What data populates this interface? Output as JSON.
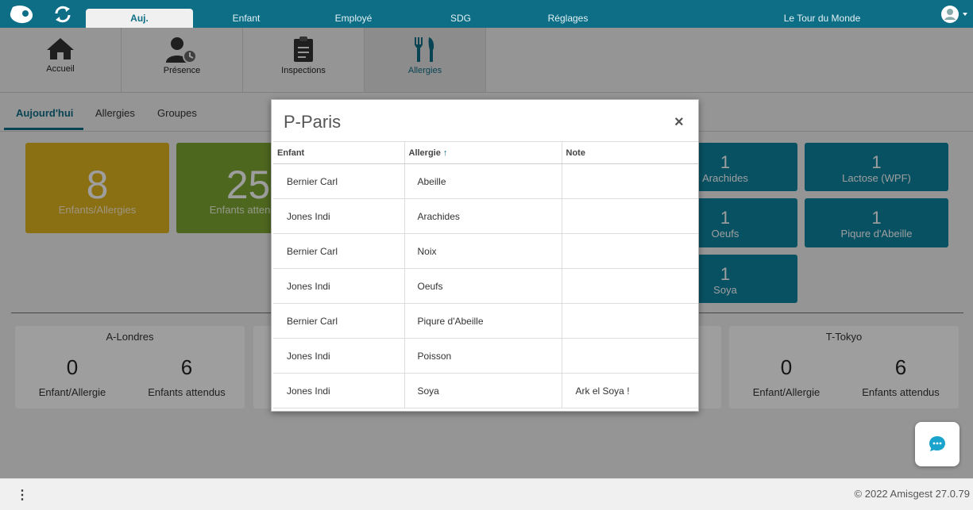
{
  "nav": {
    "tabs": [
      "Auj.",
      "Enfant",
      "Employé",
      "SDG",
      "Réglages",
      "Le Tour du Monde"
    ]
  },
  "toolbar": {
    "items": [
      "Accueil",
      "Présence",
      "Inspections",
      "Allergies"
    ]
  },
  "subtabs": [
    "Aujourd'hui",
    "Allergies",
    "Groupes"
  ],
  "stats": {
    "allergy_count": "8",
    "allergy_label": "Enfants/Allergies",
    "expected_count": "25",
    "expected_label": "Enfants attendus"
  },
  "allergy_tiles": [
    {
      "count": "1",
      "name": "Arachides"
    },
    {
      "count": "1",
      "name": "Lactose (WPF)"
    },
    {
      "count": "1",
      "name": "Oeufs"
    },
    {
      "count": "1",
      "name": "Piqure d'Abeille"
    },
    {
      "count": "1",
      "name": "Soya"
    }
  ],
  "groups": [
    {
      "name": "A-Londres",
      "allergy": "0",
      "allergy_label": "Enfant/Allergie",
      "expected": "6",
      "expected_label": "Enfants attendus"
    },
    {
      "name": "T-Tokyo",
      "allergy": "0",
      "allergy_label": "Enfant/Allergie",
      "expected": "6",
      "expected_label": "Enfants attendus"
    }
  ],
  "modal": {
    "title": "P-Paris",
    "close": "×",
    "columns": [
      "Enfant",
      "Allergie",
      "Note"
    ],
    "sort_indicator": "↑",
    "rows": [
      {
        "child": "Bernier Carl",
        "allergy": "Abeille",
        "note": ""
      },
      {
        "child": "Jones Indi",
        "allergy": "Arachides",
        "note": ""
      },
      {
        "child": "Bernier Carl",
        "allergy": "Noix",
        "note": ""
      },
      {
        "child": "Jones Indi",
        "allergy": "Oeufs",
        "note": ""
      },
      {
        "child": "Bernier Carl",
        "allergy": "Piqure d'Abeille",
        "note": ""
      },
      {
        "child": "Jones Indi",
        "allergy": "Poisson",
        "note": ""
      },
      {
        "child": "Jones Indi",
        "allergy": "Soya",
        "note": "Ark el Soya !"
      }
    ]
  },
  "footer": {
    "menu": "⋮",
    "copyright": "© 2022 Amisgest 27.0.79"
  },
  "colors": {
    "brand": "#0d6e86",
    "tile": "#0d84a0",
    "yellow": "#e1b420",
    "green": "#7ea733"
  }
}
